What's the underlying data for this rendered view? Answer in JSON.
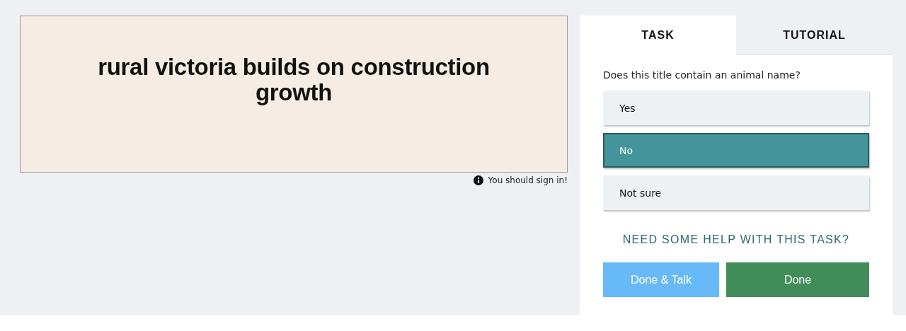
{
  "subject": {
    "headline": "rural victoria builds on construction growth"
  },
  "notice": {
    "text": "You should sign in!"
  },
  "tabs": [
    {
      "label": "TASK",
      "selected": true
    },
    {
      "label": "TUTORIAL",
      "selected": false
    }
  ],
  "question": "Does this title contain an animal name?",
  "answers": [
    {
      "label": "Yes",
      "selected": false
    },
    {
      "label": "No",
      "selected": true
    },
    {
      "label": "Not sure",
      "selected": false
    }
  ],
  "help_link": "NEED SOME HELP WITH THIS TASK?",
  "buttons": [
    {
      "label": "Done & Talk",
      "kind": "talk"
    },
    {
      "label": "Done",
      "kind": "done"
    }
  ]
}
